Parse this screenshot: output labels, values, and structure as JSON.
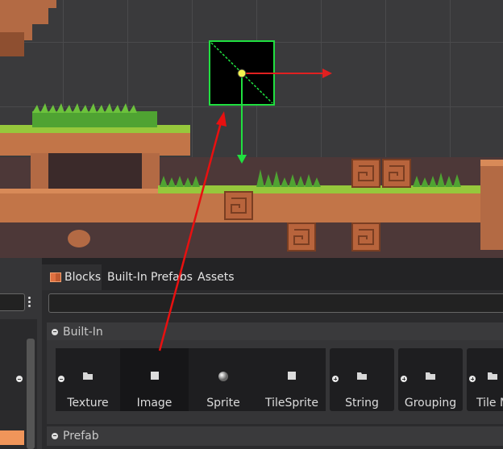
{
  "tabs": [
    "Blocks",
    "Built-In",
    "Prefabs",
    "Assets"
  ],
  "search": {
    "placeholder": ""
  },
  "sections": {
    "builtin": "Built-In",
    "prefab": "Prefab"
  },
  "blocks": [
    {
      "label": "Texture",
      "icon": "folder-icon"
    },
    {
      "label": "Image",
      "icon": "square-icon"
    },
    {
      "label": "Sprite",
      "icon": "sphere-icon"
    },
    {
      "label": "TileSprite",
      "icon": "square-icon"
    },
    {
      "label": "String",
      "icon": "folder-icon"
    },
    {
      "label": "Grouping",
      "icon": "folder-icon"
    },
    {
      "label": "Tile M",
      "icon": "folder-icon"
    }
  ],
  "colors": {
    "accent_orange": "#f0955a",
    "selection_green": "#20e040",
    "arrow_red": "#e02020"
  }
}
